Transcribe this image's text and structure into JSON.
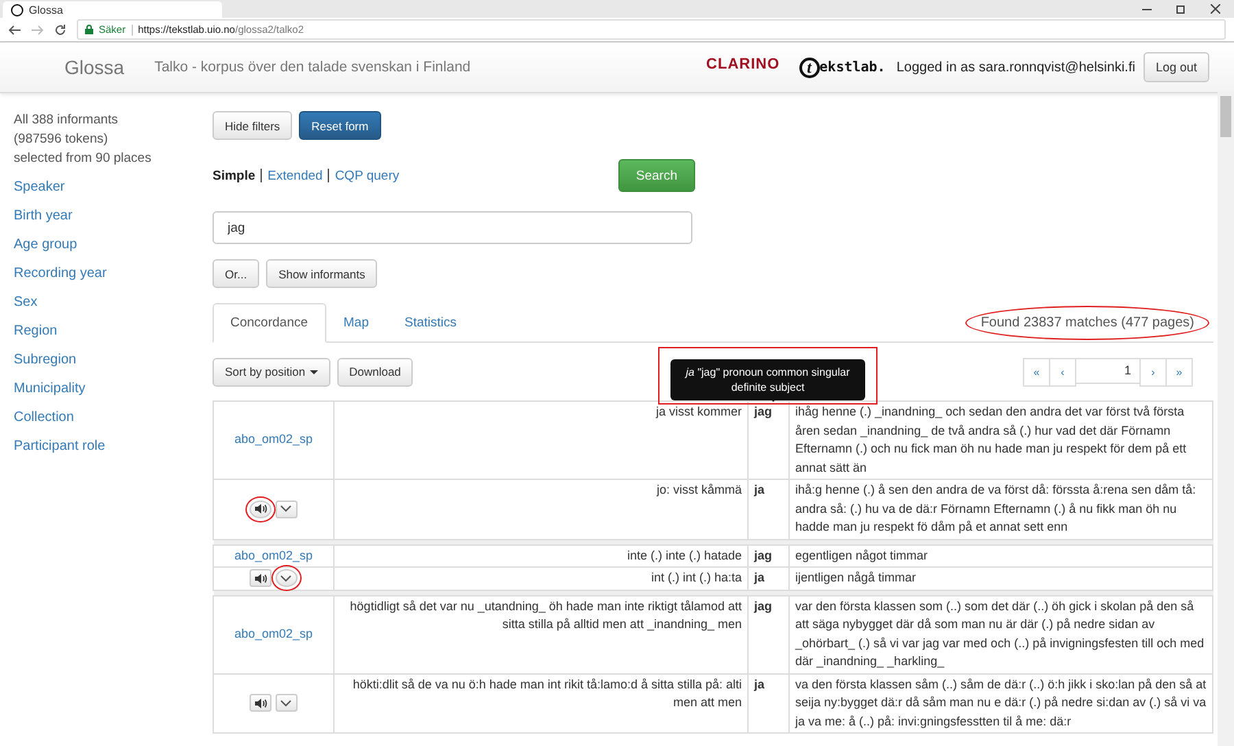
{
  "browser": {
    "tab_title": "Glossa",
    "secure_label": "Säker",
    "url_host": "https://tekstlab.uio.no",
    "url_path": "/glossa2/talko2"
  },
  "navbar": {
    "brand": "Glossa",
    "subtitle": "Talko - korpus över den talade svenskan i Finland",
    "logo_1": "CLARINO",
    "logo_2": "ekstlab.",
    "logo_2_initial": "t",
    "logged_in": "Logged in as sara.ronnqvist@helsinki.fi",
    "logout_button": "Log out"
  },
  "sidebar": {
    "summary": [
      "All 388 informants",
      "(987596 tokens)",
      "selected from 90 places"
    ],
    "filters": [
      "Speaker",
      "Birth year",
      "Age group",
      "Recording year",
      "Sex",
      "Region",
      "Subregion",
      "Municipality",
      "Collection",
      "Participant role"
    ]
  },
  "form": {
    "hide_filters": "Hide filters",
    "reset_form": "Reset form",
    "modes": [
      {
        "label": "Simple",
        "selected": true
      },
      {
        "label": "Extended",
        "selected": false
      },
      {
        "label": "CQP query",
        "selected": false
      }
    ],
    "search_button": "Search",
    "query": "jag",
    "or_button": "Or...",
    "show_informants": "Show informants"
  },
  "tabs": [
    {
      "label": "Concordance",
      "selected": true
    },
    {
      "label": "Map",
      "selected": false
    },
    {
      "label": "Statistics",
      "selected": false
    }
  ],
  "toolbar": {
    "sort_button": "Sort by position",
    "download": "Download",
    "match_count": "Found 23837 matches (477 pages)",
    "match_count_circled": true
  },
  "pagination": {
    "first": "«",
    "prev": "‹",
    "page": "1",
    "next": "›",
    "last": "»"
  },
  "tooltip": {
    "text": "*ja* \"jag\" pronoun common singular definite subject",
    "boxed": true
  },
  "results": [
    {
      "speaker": "abo_om02_sp",
      "audio_circled": true,
      "expand_circled": false,
      "lines": [
        {
          "left": "ja visst kommer",
          "keyword": "jag",
          "right": "ihåg henne (.) _inandning_ och sedan den andra det var först två första åren sedan _inandning_ de två andra så (.) hur vad det där Förnamn Efternamn (.) och nu fick man öh nu hade man ju respekt för dem på ett annat sätt än"
        },
        {
          "left": "jo: visst kåmmä",
          "keyword": "ja",
          "right": "ihå:g henne (.) å sen den andra de va först då: förssta å:rena sen dåm tå: andra så: (.) hu va de dä:r Förnamn Efternamn (.) å nu fikk man öh nu hadde man ju respekt fö dåm på et annat sett enn"
        }
      ]
    },
    {
      "speaker": "abo_om02_sp",
      "audio_circled": false,
      "expand_circled": true,
      "lines": [
        {
          "left": "inte (.) inte (.) hatade",
          "keyword": "jag",
          "right": "egentligen något timmar"
        },
        {
          "left": "int (.) int (.) ha:ta",
          "keyword": "ja",
          "right": "ijentligen någå timmar"
        }
      ]
    },
    {
      "speaker": "abo_om02_sp",
      "audio_circled": false,
      "expand_circled": false,
      "lines": [
        {
          "left": "högtidligt så det var nu _utandning_ öh hade man inte riktigt tålamod att sitta stilla på alltid men att _inandning_ men",
          "keyword": "jag",
          "right": "var den första klassen som (..) som det där (..) öh gick i skolan på den så att säga nybygget där då som man nu är där (.) på nedre sidan av _ohörbart_ (.) så vi var jag var med och (..) på invigningsfesten till och med där _inandning_ _harkling_"
        },
        {
          "left": "hökti:dlit så de va nu ö:h hade man int rikit tå:lamo:d å sitta stilla på: alti men att men",
          "keyword": "ja",
          "right": "va den första klassen såm (..) såm de dä:r (..) ö:h jikk i sko:lan på den så at seija ny:bygget dä:r då såm man nu e dä:r (.) på nedre si:dan av (.) så vi va ja va me: å (..) på: invi:gningsfesstten til å me: dä:r"
        }
      ]
    }
  ]
}
